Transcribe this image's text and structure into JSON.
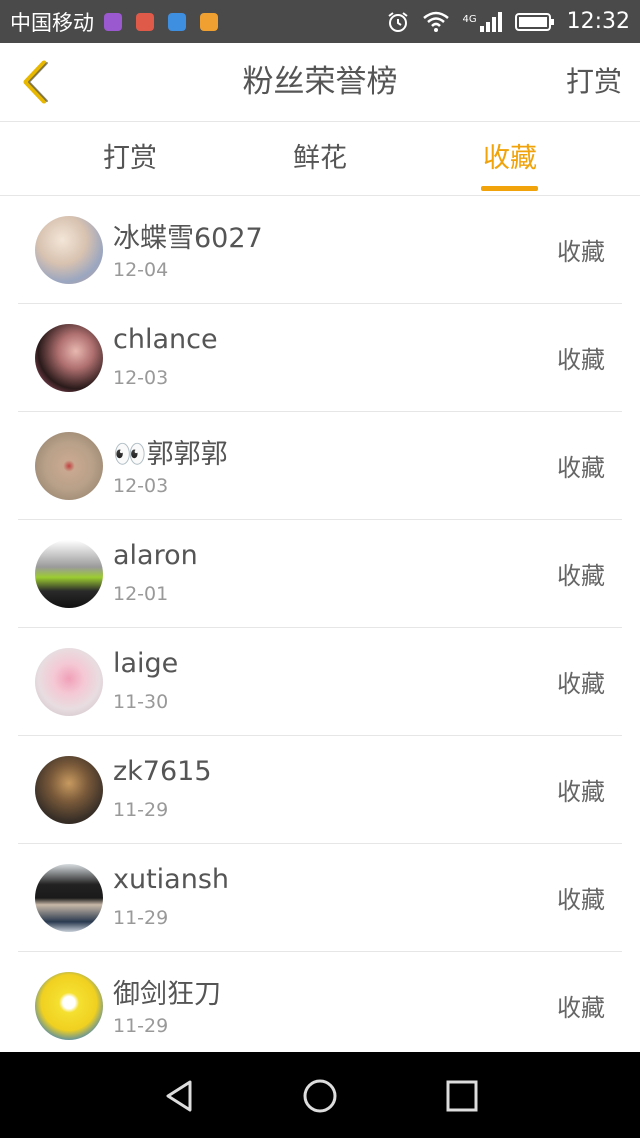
{
  "status_bar": {
    "carrier": "中国移动",
    "time": "12:32",
    "network": "4G"
  },
  "header": {
    "title": "粉丝荣誉榜",
    "reward_link": "打赏"
  },
  "tabs": [
    {
      "label": "打赏"
    },
    {
      "label": "鲜花"
    },
    {
      "label": "收藏"
    }
  ],
  "active_tab": "收藏",
  "accent_color": "#f0a30a",
  "fans": [
    {
      "name": "冰蝶雪6027",
      "date": "12-04",
      "action": "收藏"
    },
    {
      "name": "chlance",
      "date": "12-03",
      "action": "收藏"
    },
    {
      "name": "👀郭郭郭",
      "date": "12-03",
      "action": "收藏"
    },
    {
      "name": "alaron",
      "date": "12-01",
      "action": "收藏"
    },
    {
      "name": "laige",
      "date": "11-30",
      "action": "收藏"
    },
    {
      "name": "zk7615",
      "date": "11-29",
      "action": "收藏"
    },
    {
      "name": "xutiansh",
      "date": "11-29",
      "action": "收藏"
    },
    {
      "name": "御剑狂刀",
      "date": "11-29",
      "action": "收藏"
    }
  ]
}
